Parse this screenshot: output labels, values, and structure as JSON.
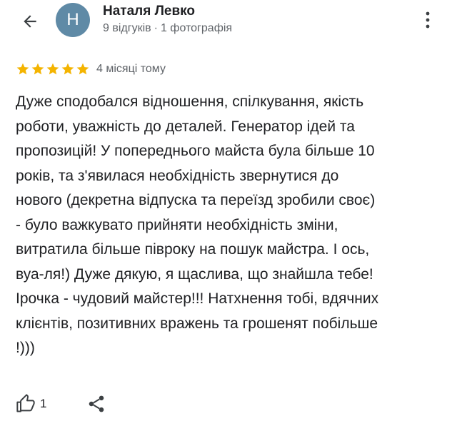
{
  "header": {
    "avatar_initial": "Н",
    "author_name": "Наталя Левко",
    "reviews_count": "9 відгуків",
    "separator": "·",
    "photos_count": "1 фотографія",
    "icons": {
      "back": "arrow-left-icon",
      "more": "more-vert-icon"
    },
    "avatar_color": "#5f8aa6"
  },
  "review": {
    "rating": 5,
    "max_rating": 5,
    "star_color": "#f4b400",
    "date": "4 місяці тому",
    "text": "Дуже сподобался відношення, спілкування, якість\nроботи, уважність до деталей. Генератор ідей та\nпропозицій! У попереднього майста була більше 10\nроків, та з'явилася необхідність звернутися до\nнового (декретна відпуска та переїзд зробили своє)\n- було важкувато прийняти необхідність зміни,\nвитратила більше півроку на пошук майстра. І ось,\nвуа-ля!) Дуже дякую, я щаслива, що знайшла тебе!\nІрочка - чудовий майстер!!! Натхнення тобі, вдячних\nклієнтів, позитивних вражень та грошенят побільше\n!)))"
  },
  "actions": {
    "like_count": "1",
    "icons": {
      "like": "thumb-up-icon",
      "share": "share-icon"
    }
  }
}
